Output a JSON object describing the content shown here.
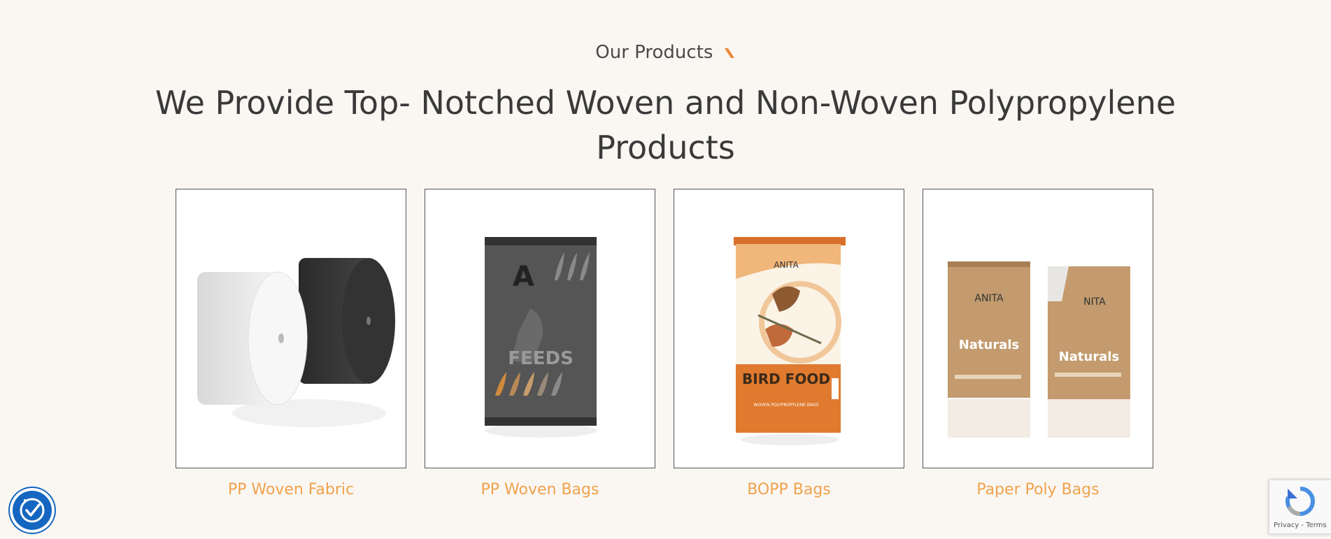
{
  "section": {
    "eyebrow": "Our Products",
    "headline": "We Provide Top- Notched Woven and Non-Woven Polypropylene Products"
  },
  "products": [
    {
      "name": "PP Woven Fabric",
      "image": "pp-woven-fabric-rolls"
    },
    {
      "name": "PP Woven Bags",
      "image": "pp-woven-feed-bag"
    },
    {
      "name": "BOPP Bags",
      "image": "bopp-bird-food-bag"
    },
    {
      "name": "Paper Poly Bags",
      "image": "paper-poly-naturals-bags"
    }
  ],
  "product_art": {
    "feeds_brand": "A",
    "feeds_label": "FEEDS",
    "bopp_brand": "ANITA",
    "bopp_label": "BIRD FOOD",
    "bopp_sub": "WOVEN POLYPROPYLENE BAGS",
    "paper_brand_left": "ANITA",
    "paper_brand_right": "NITA",
    "paper_label": "Naturals"
  },
  "recaptcha": {
    "links": "Privacy - Terms"
  },
  "colors": {
    "accent": "#f0a24c",
    "background": "#faf7f3",
    "badge": "#1466c0"
  }
}
